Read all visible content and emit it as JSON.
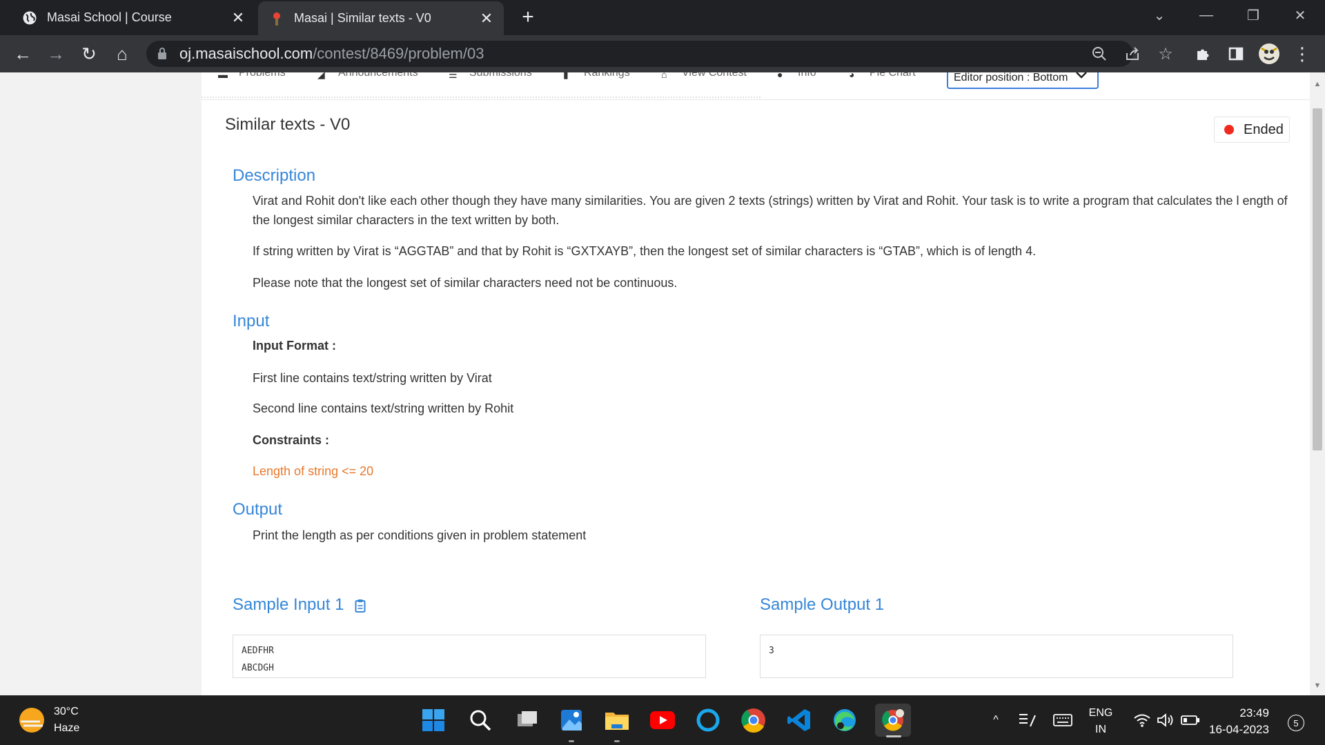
{
  "browser": {
    "tabs": [
      {
        "title": "Masai School | Course",
        "favicon": "globe-icon",
        "active": false
      },
      {
        "title": "Masai | Similar texts - V0",
        "favicon": "masai-favicon",
        "active": true
      }
    ],
    "url_host": "oj.masaischool.com",
    "url_path": "/contest/8469/problem/03"
  },
  "subnav": {
    "items": [
      "Problems",
      "Announcements",
      "Submissions",
      "Rankings",
      "View Contest",
      "Info",
      "Pie Chart"
    ],
    "editor_position": "Editor position : Bottom"
  },
  "problem": {
    "title": "Similar texts - V0",
    "status": "Ended",
    "description_heading": "Description",
    "description": [
      "Virat and Rohit don't like each other though they have many similarities. You are given 2 texts (strings) written by Virat and Rohit. Your task is to write a program that calculates the l ength of the longest similar characters in the text written by both.",
      "If string written by Virat is “AGGTAB” and that by Rohit is “GXTXAYB”, then the longest set of similar characters is “GTAB”, which is of length 4.",
      "Please note that the longest set of similar characters need not be continuous."
    ],
    "input_heading": "Input",
    "input_format_label": "Input Format :",
    "input_lines": [
      "First line contains text/string written by Virat",
      "Second line contains text/string written by Rohit"
    ],
    "constraints_label": "Constraints :",
    "constraint": "Length of string <= 20",
    "output_heading": "Output",
    "output_text": "Print the length as per conditions given in problem statement",
    "sample_input_heading": "Sample Input 1",
    "sample_input_lines": [
      "AEDFHR",
      "ABCDGH"
    ],
    "sample_output_heading": "Sample Output 1",
    "sample_output_lines": [
      "3"
    ]
  },
  "taskbar": {
    "weather_temp": "30°C",
    "weather_desc": "Haze",
    "lang_top": "ENG",
    "lang_bottom": "IN",
    "time": "23:49",
    "date": "16-04-2023",
    "notification_count": "5"
  },
  "colors": {
    "accent_blue": "#3686d8",
    "constraint_orange": "#e8782a",
    "ended_red": "#f0291e"
  }
}
